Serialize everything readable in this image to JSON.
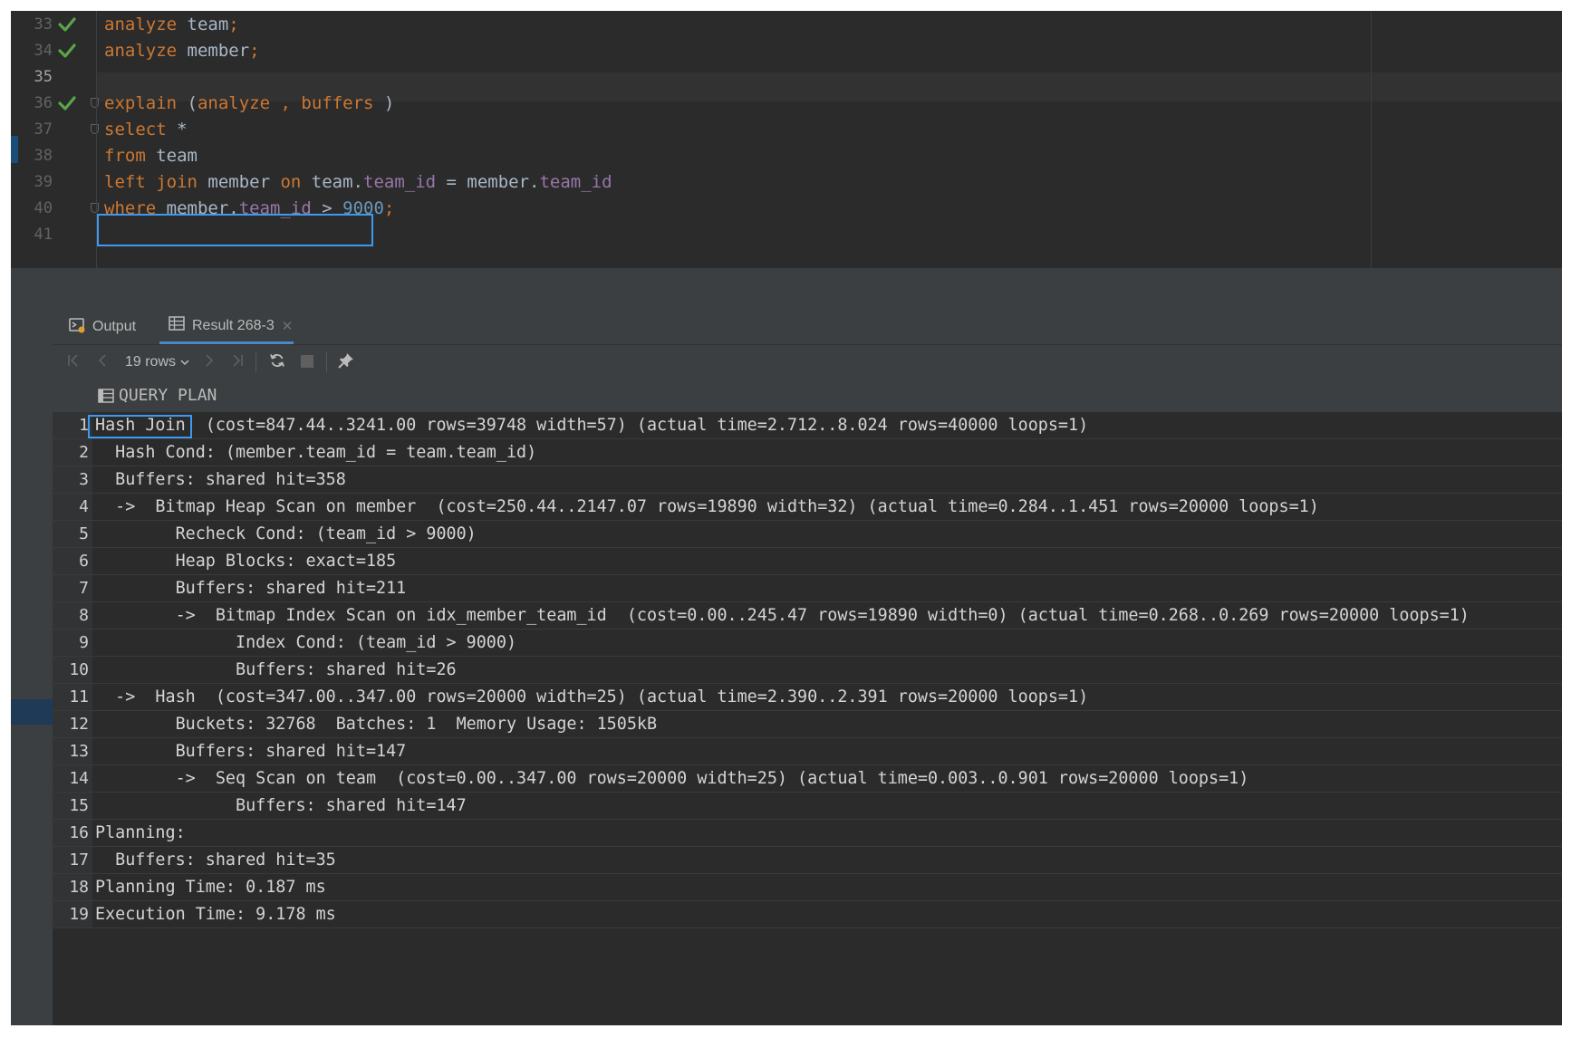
{
  "editor": {
    "lines": [
      {
        "n": "33",
        "check": true,
        "parts": [
          {
            "t": "analyze",
            "c": "kw"
          },
          {
            "t": " team"
          },
          {
            "t": ";",
            "c": "kw"
          }
        ]
      },
      {
        "n": "34",
        "check": true,
        "parts": [
          {
            "t": "analyze",
            "c": "kw"
          },
          {
            "t": " member"
          },
          {
            "t": ";",
            "c": "kw"
          }
        ]
      },
      {
        "n": "35",
        "check": false,
        "parts": []
      },
      {
        "n": "36",
        "check": true,
        "parts": [
          {
            "t": "explain",
            "c": "kw"
          },
          {
            "t": " ("
          },
          {
            "t": "analyze ,",
            "c": "kw"
          },
          {
            "t": " "
          },
          {
            "t": "buffers",
            "c": "kw"
          },
          {
            "t": " )"
          }
        ]
      },
      {
        "n": "37",
        "check": false,
        "parts": [
          {
            "t": "select",
            "c": "kw"
          },
          {
            "t": " *"
          }
        ]
      },
      {
        "n": "38",
        "check": false,
        "parts": [
          {
            "t": "from",
            "c": "kw"
          },
          {
            "t": " team"
          }
        ]
      },
      {
        "n": "39",
        "check": false,
        "parts": [
          {
            "t": "left join",
            "c": "kw"
          },
          {
            "t": " member "
          },
          {
            "t": "on",
            "c": "kw"
          },
          {
            "t": " team."
          },
          {
            "t": "team_id",
            "c": "fld"
          },
          {
            "t": " = member."
          },
          {
            "t": "team_id",
            "c": "fld"
          }
        ]
      },
      {
        "n": "40",
        "check": false,
        "parts": [
          {
            "t": "where",
            "c": "kw"
          },
          {
            "t": " member."
          },
          {
            "t": "team_id",
            "c": "fld"
          },
          {
            "t": " > "
          },
          {
            "t": "9000",
            "c": "num"
          },
          {
            "t": ";",
            "c": "kw"
          }
        ]
      },
      {
        "n": "41",
        "check": false,
        "parts": []
      }
    ]
  },
  "results": {
    "tabs": {
      "output": "Output",
      "result": "Result 268-3"
    },
    "toolbar": {
      "rows_label": "19 rows"
    },
    "column_header": "QUERY PLAN",
    "rows": [
      {
        "n": "1",
        "text": "Hash Join  (cost=847.44..3241.00 rows=39748 width=57) (actual time=2.712..8.024 rows=40000 loops=1)"
      },
      {
        "n": "2",
        "text": "  Hash Cond: (member.team_id = team.team_id)"
      },
      {
        "n": "3",
        "text": "  Buffers: shared hit=358"
      },
      {
        "n": "4",
        "text": "  ->  Bitmap Heap Scan on member  (cost=250.44..2147.07 rows=19890 width=32) (actual time=0.284..1.451 rows=20000 loops=1)"
      },
      {
        "n": "5",
        "text": "        Recheck Cond: (team_id > 9000)"
      },
      {
        "n": "6",
        "text": "        Heap Blocks: exact=185"
      },
      {
        "n": "7",
        "text": "        Buffers: shared hit=211"
      },
      {
        "n": "8",
        "text": "        ->  Bitmap Index Scan on idx_member_team_id  (cost=0.00..245.47 rows=19890 width=0) (actual time=0.268..0.269 rows=20000 loops=1)"
      },
      {
        "n": "9",
        "text": "              Index Cond: (team_id > 9000)"
      },
      {
        "n": "10",
        "text": "              Buffers: shared hit=26"
      },
      {
        "n": "11",
        "text": "  ->  Hash  (cost=347.00..347.00 rows=20000 width=25) (actual time=2.390..2.391 rows=20000 loops=1)"
      },
      {
        "n": "12",
        "text": "        Buckets: 32768  Batches: 1  Memory Usage: 1505kB"
      },
      {
        "n": "13",
        "text": "        Buffers: shared hit=147"
      },
      {
        "n": "14",
        "text": "        ->  Seq Scan on team  (cost=0.00..347.00 rows=20000 width=25) (actual time=0.003..0.901 rows=20000 loops=1)"
      },
      {
        "n": "15",
        "text": "              Buffers: shared hit=147"
      },
      {
        "n": "16",
        "text": "Planning:"
      },
      {
        "n": "17",
        "text": "  Buffers: shared hit=35"
      },
      {
        "n": "18",
        "text": "Planning Time: 0.187 ms"
      },
      {
        "n": "19",
        "text": "Execution Time: 9.178 ms"
      }
    ]
  },
  "colors": {
    "keyword": "#cc7832",
    "field": "#9876aa",
    "number": "#6897bb",
    "highlight": "#3d9aef",
    "check": "#5aa54a"
  }
}
